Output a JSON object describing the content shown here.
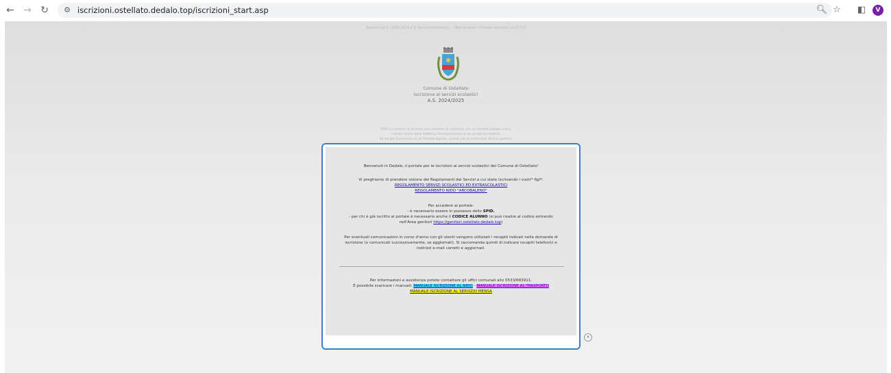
{
  "browser": {
    "url": "iscrizioni.ostellato.dedalo.top/iscrizioni_start.asp",
    "avatar_letter": "V",
    "accent": "#7b1fa2"
  },
  "header": {
    "topline": "Dedalo.top © 2003-2024 A.S. Servizi Informatici — Web browser: Chrome versione 122.0.0.0",
    "comune": "Comune di Ostellato",
    "subtitle": "Iscrizione ai servizi scolastici",
    "year": "A.S. 2024/2025"
  },
  "spid": {
    "line1": "SPID è il sistema di accesso che consente di utilizzare, con un'identità digitale unica,",
    "line2": "i servizi online della Pubblica Amministrazione e dei privati accreditati.",
    "line3": "Se sei già in possesso di un'identità digitale, accedi con le credenziali del tuo gestore."
  },
  "modal": {
    "welcome": "Benvenuti in Dedalo, il portale per le iscrizioni ai servizi scolastici del Comune di Ostellato!",
    "regolamenti_intro": "Vi preghiamo di prendere visione dei Regolamenti dei Servizi a cui state iscrivendo i vostr* figl*:",
    "link_reg1": "REGOLAMENTO SERVIZI SCOLASTICI ED EXTRASCOLASTICI",
    "link_reg2": "REGOLAMENTO NIDO \"ARCOBALENO\"",
    "accesso_title": "Per accedere al portale:",
    "accesso_l1_pre": "- è necessario essere in possesso dello ",
    "accesso_l1_bold": "SPID.",
    "accesso_l2_pre": "- per chi è già iscritto al portale è necessario anche il ",
    "accesso_l2_bold": "CODICE ALUNNO",
    "accesso_l2_post": " (si può risalire al codice entrando",
    "accesso_l3_pre": "nell'Area genitori ",
    "accesso_l3_link": "https://genitori.ostellato.dedalo.top",
    "accesso_l3_post": ")",
    "comunic_l1": "Per eventuali comunicazioni in corso d'anno con gli utenti vengono utilizzati i recapiti indicati nella domanda di",
    "comunic_l2": "iscrizione (o comunicati successivamente, se aggiornati). Si raccomanda quindi di indicare recapiti telefonici e",
    "comunic_l3": "indirizzi e-mail corretti e aggiornati.",
    "info": "Per informazioni e assistenza potete contattare gli uffici comunali allo 0533/683911.",
    "manuali_pre": "È possibile scaricare i manuali: ",
    "man_nido": "MANUALE ISCRIZIONE AL NIDO",
    "man_sep": " - ",
    "man_trasporto": "MANUALE ISCRIZIONE AL TRASPORTO",
    "man_mensa": "MANUALE  ISCRIZIONE AL SERVIZIO MENSA",
    "close": "×"
  }
}
